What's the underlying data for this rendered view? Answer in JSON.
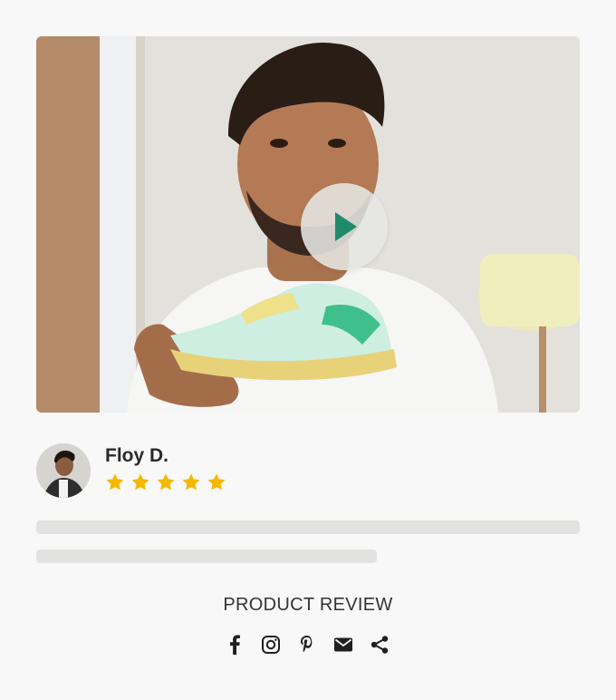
{
  "review": {
    "author": "Floy D.",
    "rating": 5,
    "rating_max": 5,
    "section_label": "PRODUCT REVIEW"
  },
  "share_icons": [
    "facebook-icon",
    "instagram-icon",
    "pinterest-icon",
    "email-icon",
    "share-icon"
  ],
  "colors": {
    "play_icon": "#1f8a6a",
    "star": "#f5b800",
    "placeholder_line": "#e2e2e1",
    "page_bg": "#f7f8f7"
  }
}
